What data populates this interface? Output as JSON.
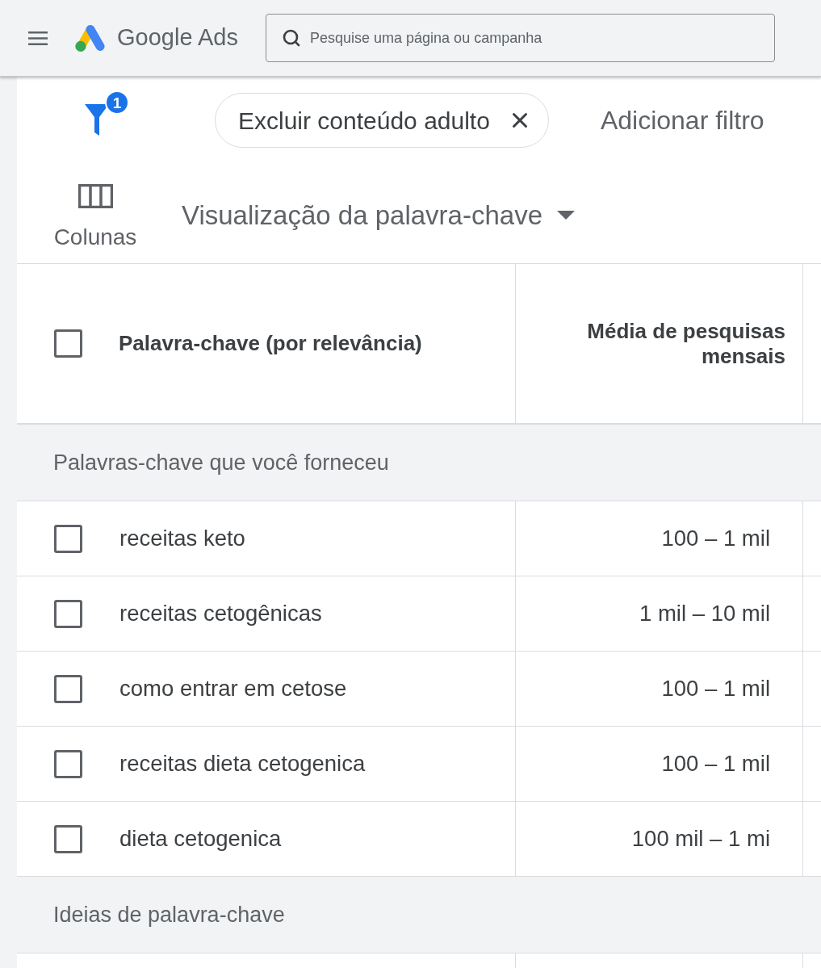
{
  "header": {
    "logo_text": "Google Ads",
    "search": {
      "placeholder": "Pesquise uma página ou campanha"
    }
  },
  "filter_bar": {
    "filter_count": "1",
    "chips": [
      {
        "label": "Excluir conteúdo adulto"
      }
    ],
    "add_filter": "Adicionar filtro"
  },
  "toolbar": {
    "columns_button": "Colunas",
    "view_dropdown": "Visualização da palavra-chave"
  },
  "table": {
    "select_all_checked": false,
    "columns": [
      "Palavra-chave (por relevância)",
      "Média de pesquisas mensais"
    ],
    "groups": [
      {
        "title": "Palavras-chave que você forneceu",
        "rows": [
          {
            "checked": false,
            "keyword": "receitas keto",
            "searches": "100 – 1 mil"
          },
          {
            "checked": false,
            "keyword": "receitas cetogênicas",
            "searches": "1 mil – 10 mil"
          },
          {
            "checked": false,
            "keyword": "como entrar em cetose",
            "searches": "100 – 1 mil"
          },
          {
            "checked": false,
            "keyword": "receitas dieta cetogenica",
            "searches": "100 – 1 mil"
          },
          {
            "checked": false,
            "keyword": "dieta cetogenica",
            "searches": "100 mil – 1 mi"
          }
        ]
      },
      {
        "title": "Ideias de palavra-chave"
      }
    ]
  }
}
